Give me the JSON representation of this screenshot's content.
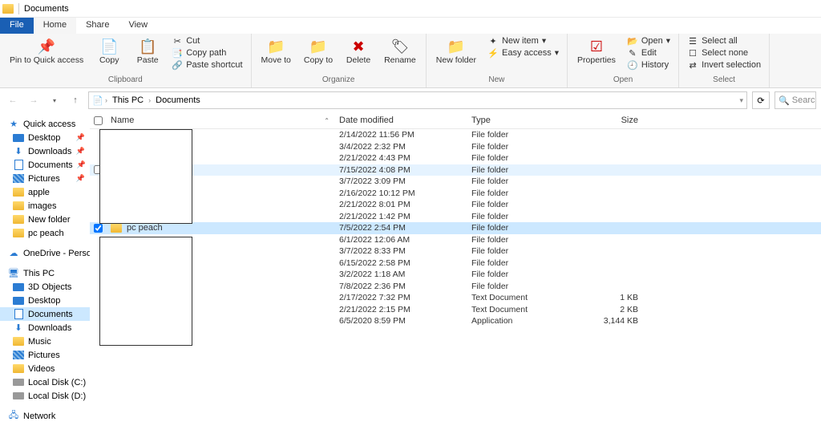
{
  "title": "Documents",
  "tabs": {
    "file": "File",
    "home": "Home",
    "share": "Share",
    "view": "View"
  },
  "ribbon": {
    "clipboard": {
      "label": "Clipboard",
      "pin": "Pin to Quick access",
      "copy": "Copy",
      "paste": "Paste",
      "cut": "Cut",
      "copypath": "Copy path",
      "shortcut": "Paste shortcut"
    },
    "organize": {
      "label": "Organize",
      "moveto": "Move to",
      "copyto": "Copy to",
      "delete": "Delete",
      "rename": "Rename"
    },
    "new": {
      "label": "New",
      "newfolder": "New folder",
      "newitem": "New item",
      "easyaccess": "Easy access"
    },
    "open": {
      "label": "Open",
      "properties": "Properties",
      "open": "Open",
      "edit": "Edit",
      "history": "History"
    },
    "select": {
      "label": "Select",
      "selectall": "Select all",
      "selectnone": "Select none",
      "invert": "Invert selection"
    }
  },
  "breadcrumb": {
    "root": "This PC",
    "current": "Documents"
  },
  "search_placeholder": "Search",
  "columns": {
    "name": "Name",
    "date": "Date modified",
    "type": "Type",
    "size": "Size"
  },
  "nav": {
    "quick": "Quick access",
    "quick_items": [
      {
        "label": "Desktop",
        "icon": "desktop",
        "pin": true
      },
      {
        "label": "Downloads",
        "icon": "down",
        "pin": true
      },
      {
        "label": "Documents",
        "icon": "doc",
        "pin": true
      },
      {
        "label": "Pictures",
        "icon": "pic",
        "pin": true
      },
      {
        "label": "apple",
        "icon": "folder",
        "pin": false
      },
      {
        "label": "images",
        "icon": "folder",
        "pin": false
      },
      {
        "label": "New folder",
        "icon": "folder",
        "pin": false
      },
      {
        "label": "pc peach",
        "icon": "folder",
        "pin": false
      }
    ],
    "onedrive": "OneDrive - Personal",
    "thispc": "This PC",
    "pc_items": [
      {
        "label": "3D Objects",
        "icon": "desktop"
      },
      {
        "label": "Desktop",
        "icon": "desktop"
      },
      {
        "label": "Documents",
        "icon": "doc",
        "sel": true
      },
      {
        "label": "Downloads",
        "icon": "down"
      },
      {
        "label": "Music",
        "icon": "folder"
      },
      {
        "label": "Pictures",
        "icon": "pic"
      },
      {
        "label": "Videos",
        "icon": "folder"
      },
      {
        "label": "Local Disk (C:)",
        "icon": "disk"
      },
      {
        "label": "Local Disk (D:)",
        "icon": "disk"
      }
    ],
    "network": "Network"
  },
  "rows": [
    {
      "name": "",
      "date": "2/14/2022 11:56 PM",
      "type": "File folder",
      "size": ""
    },
    {
      "name": "",
      "date": "3/4/2022 2:32 PM",
      "type": "File folder",
      "size": ""
    },
    {
      "name": "",
      "date": "2/21/2022 4:43 PM",
      "type": "File folder",
      "size": ""
    },
    {
      "name": "",
      "date": "7/15/2022 4:08 PM",
      "type": "File folder",
      "size": "",
      "hover": true
    },
    {
      "name": "",
      "date": "3/7/2022 3:09 PM",
      "type": "File folder",
      "size": ""
    },
    {
      "name": "",
      "date": "2/16/2022 10:12 PM",
      "type": "File folder",
      "size": ""
    },
    {
      "name": "",
      "date": "2/21/2022 8:01 PM",
      "type": "File folder",
      "size": ""
    },
    {
      "name": "",
      "date": "2/21/2022 1:42 PM",
      "type": "File folder",
      "size": ""
    },
    {
      "name": "pc peach",
      "date": "7/5/2022 2:54 PM",
      "type": "File folder",
      "size": "",
      "sel": true,
      "checked": true
    },
    {
      "name": "",
      "date": "6/1/2022 12:06 AM",
      "type": "File folder",
      "size": ""
    },
    {
      "name": "",
      "date": "3/7/2022 8:33 PM",
      "type": "File folder",
      "size": ""
    },
    {
      "name": "",
      "date": "6/15/2022 2:58 PM",
      "type": "File folder",
      "size": ""
    },
    {
      "name": "",
      "date": "3/2/2022 1:18 AM",
      "type": "File folder",
      "size": ""
    },
    {
      "name": "",
      "date": "7/8/2022 2:36 PM",
      "type": "File folder",
      "size": ""
    },
    {
      "name": "",
      "date": "2/17/2022 7:32 PM",
      "type": "Text Document",
      "size": "1 KB"
    },
    {
      "name": "",
      "date": "2/21/2022 2:15 PM",
      "type": "Text Document",
      "size": "2 KB"
    },
    {
      "name": "",
      "date": "6/5/2020 8:59 PM",
      "type": "Application",
      "size": "3,144 KB"
    }
  ]
}
